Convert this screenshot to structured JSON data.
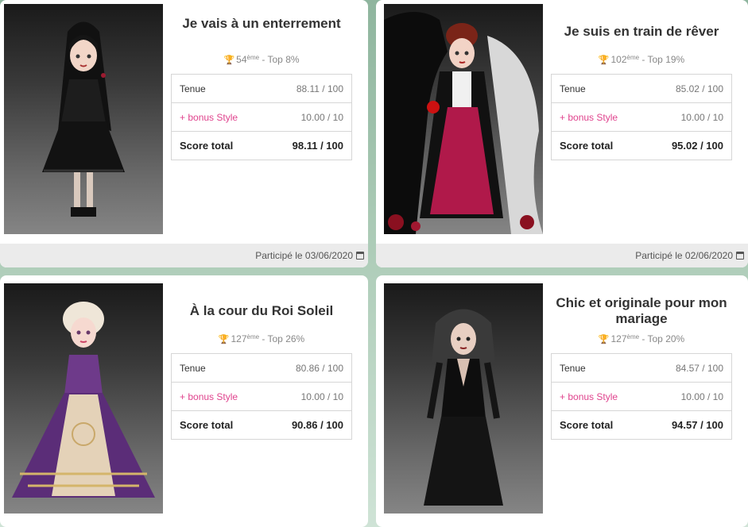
{
  "cards": [
    {
      "title": "Je vais à un enterrement",
      "rank_num": "54",
      "rank_sup": "ème",
      "rank_top": " - Top 8%",
      "tenue_label": "Tenue",
      "tenue_value": "88.11 / 100",
      "bonus_label": "+ bonus Style",
      "bonus_value": "10.00 / 10",
      "total_label": "Score total",
      "total_value": "98.11 / 100",
      "participated": "Participé le 03/06/2020"
    },
    {
      "title": "Je suis en train de rêver",
      "rank_num": "102",
      "rank_sup": "ème",
      "rank_top": " - Top 19%",
      "tenue_label": "Tenue",
      "tenue_value": "85.02 / 100",
      "bonus_label": "+ bonus Style",
      "bonus_value": "10.00 / 10",
      "total_label": "Score total",
      "total_value": "95.02 / 100",
      "participated": "Participé le 02/06/2020"
    },
    {
      "title": "À la cour du Roi Soleil",
      "rank_num": "127",
      "rank_sup": "ème",
      "rank_top": " - Top 26%",
      "tenue_label": "Tenue",
      "tenue_value": "80.86 / 100",
      "bonus_label": "+ bonus Style",
      "bonus_value": "10.00 / 10",
      "total_label": "Score total",
      "total_value": "90.86 / 100"
    },
    {
      "title": "Chic et originale pour mon mariage",
      "rank_num": "127",
      "rank_sup": "ème",
      "rank_top": " - Top 20%",
      "tenue_label": "Tenue",
      "tenue_value": "84.57 / 100",
      "bonus_label": "+ bonus Style",
      "bonus_value": "10.00 / 10",
      "total_label": "Score total",
      "total_value": "94.57 / 100"
    }
  ],
  "colors": {
    "bonus": "#e0448e",
    "footer_bg": "#ebebeb",
    "background": "#a9c9b4"
  },
  "icons": {
    "rank": "trophy-icon",
    "date": "calendar-icon"
  }
}
